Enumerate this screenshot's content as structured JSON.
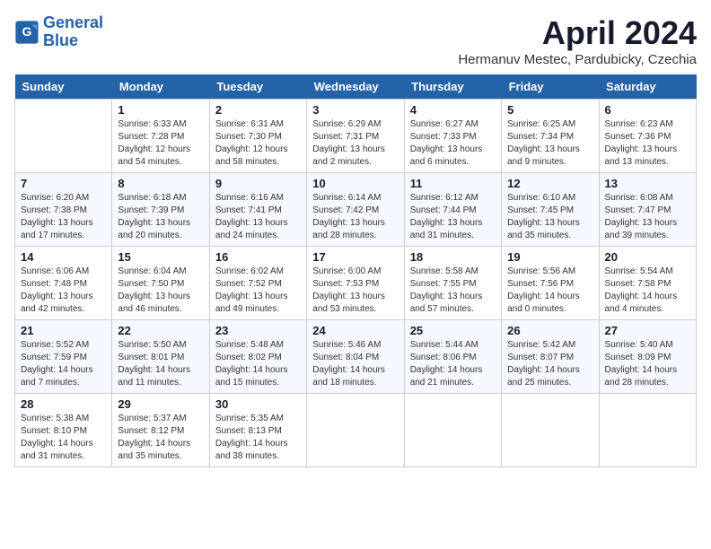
{
  "header": {
    "logo_line1": "General",
    "logo_line2": "Blue",
    "month_title": "April 2024",
    "location": "Hermanuv Mestec, Pardubicky, Czechia"
  },
  "weekdays": [
    "Sunday",
    "Monday",
    "Tuesday",
    "Wednesday",
    "Thursday",
    "Friday",
    "Saturday"
  ],
  "weeks": [
    [
      {
        "day": "",
        "info": ""
      },
      {
        "day": "1",
        "info": "Sunrise: 6:33 AM\nSunset: 7:28 PM\nDaylight: 12 hours\nand 54 minutes."
      },
      {
        "day": "2",
        "info": "Sunrise: 6:31 AM\nSunset: 7:30 PM\nDaylight: 12 hours\nand 58 minutes."
      },
      {
        "day": "3",
        "info": "Sunrise: 6:29 AM\nSunset: 7:31 PM\nDaylight: 13 hours\nand 2 minutes."
      },
      {
        "day": "4",
        "info": "Sunrise: 6:27 AM\nSunset: 7:33 PM\nDaylight: 13 hours\nand 6 minutes."
      },
      {
        "day": "5",
        "info": "Sunrise: 6:25 AM\nSunset: 7:34 PM\nDaylight: 13 hours\nand 9 minutes."
      },
      {
        "day": "6",
        "info": "Sunrise: 6:23 AM\nSunset: 7:36 PM\nDaylight: 13 hours\nand 13 minutes."
      }
    ],
    [
      {
        "day": "7",
        "info": "Sunrise: 6:20 AM\nSunset: 7:38 PM\nDaylight: 13 hours\nand 17 minutes."
      },
      {
        "day": "8",
        "info": "Sunrise: 6:18 AM\nSunset: 7:39 PM\nDaylight: 13 hours\nand 20 minutes."
      },
      {
        "day": "9",
        "info": "Sunrise: 6:16 AM\nSunset: 7:41 PM\nDaylight: 13 hours\nand 24 minutes."
      },
      {
        "day": "10",
        "info": "Sunrise: 6:14 AM\nSunset: 7:42 PM\nDaylight: 13 hours\nand 28 minutes."
      },
      {
        "day": "11",
        "info": "Sunrise: 6:12 AM\nSunset: 7:44 PM\nDaylight: 13 hours\nand 31 minutes."
      },
      {
        "day": "12",
        "info": "Sunrise: 6:10 AM\nSunset: 7:45 PM\nDaylight: 13 hours\nand 35 minutes."
      },
      {
        "day": "13",
        "info": "Sunrise: 6:08 AM\nSunset: 7:47 PM\nDaylight: 13 hours\nand 39 minutes."
      }
    ],
    [
      {
        "day": "14",
        "info": "Sunrise: 6:06 AM\nSunset: 7:48 PM\nDaylight: 13 hours\nand 42 minutes."
      },
      {
        "day": "15",
        "info": "Sunrise: 6:04 AM\nSunset: 7:50 PM\nDaylight: 13 hours\nand 46 minutes."
      },
      {
        "day": "16",
        "info": "Sunrise: 6:02 AM\nSunset: 7:52 PM\nDaylight: 13 hours\nand 49 minutes."
      },
      {
        "day": "17",
        "info": "Sunrise: 6:00 AM\nSunset: 7:53 PM\nDaylight: 13 hours\nand 53 minutes."
      },
      {
        "day": "18",
        "info": "Sunrise: 5:58 AM\nSunset: 7:55 PM\nDaylight: 13 hours\nand 57 minutes."
      },
      {
        "day": "19",
        "info": "Sunrise: 5:56 AM\nSunset: 7:56 PM\nDaylight: 14 hours\nand 0 minutes."
      },
      {
        "day": "20",
        "info": "Sunrise: 5:54 AM\nSunset: 7:58 PM\nDaylight: 14 hours\nand 4 minutes."
      }
    ],
    [
      {
        "day": "21",
        "info": "Sunrise: 5:52 AM\nSunset: 7:59 PM\nDaylight: 14 hours\nand 7 minutes."
      },
      {
        "day": "22",
        "info": "Sunrise: 5:50 AM\nSunset: 8:01 PM\nDaylight: 14 hours\nand 11 minutes."
      },
      {
        "day": "23",
        "info": "Sunrise: 5:48 AM\nSunset: 8:02 PM\nDaylight: 14 hours\nand 15 minutes."
      },
      {
        "day": "24",
        "info": "Sunrise: 5:46 AM\nSunset: 8:04 PM\nDaylight: 14 hours\nand 18 minutes."
      },
      {
        "day": "25",
        "info": "Sunrise: 5:44 AM\nSunset: 8:06 PM\nDaylight: 14 hours\nand 21 minutes."
      },
      {
        "day": "26",
        "info": "Sunrise: 5:42 AM\nSunset: 8:07 PM\nDaylight: 14 hours\nand 25 minutes."
      },
      {
        "day": "27",
        "info": "Sunrise: 5:40 AM\nSunset: 8:09 PM\nDaylight: 14 hours\nand 28 minutes."
      }
    ],
    [
      {
        "day": "28",
        "info": "Sunrise: 5:38 AM\nSunset: 8:10 PM\nDaylight: 14 hours\nand 31 minutes."
      },
      {
        "day": "29",
        "info": "Sunrise: 5:37 AM\nSunset: 8:12 PM\nDaylight: 14 hours\nand 35 minutes."
      },
      {
        "day": "30",
        "info": "Sunrise: 5:35 AM\nSunset: 8:13 PM\nDaylight: 14 hours\nand 38 minutes."
      },
      {
        "day": "",
        "info": ""
      },
      {
        "day": "",
        "info": ""
      },
      {
        "day": "",
        "info": ""
      },
      {
        "day": "",
        "info": ""
      }
    ]
  ]
}
